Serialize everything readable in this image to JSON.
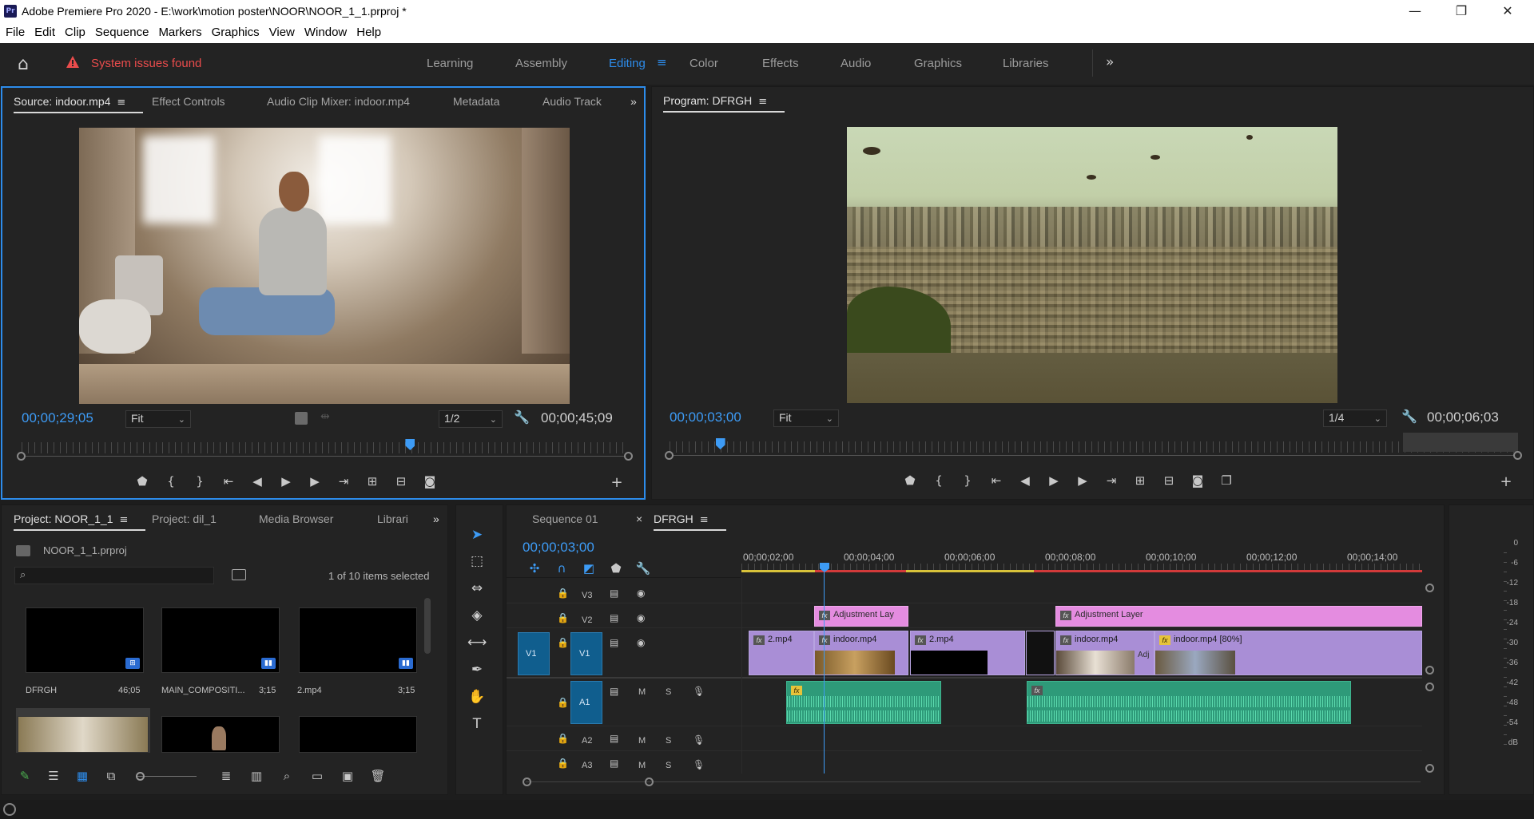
{
  "window": {
    "title": "Adobe Premiere Pro 2020 - E:\\work\\motion poster\\NOOR\\NOOR_1_1.prproj *",
    "app_badge": "Pr",
    "minimize": "—",
    "restore": "❐",
    "close": "✕"
  },
  "menu": [
    "File",
    "Edit",
    "Clip",
    "Sequence",
    "Markers",
    "Graphics",
    "View",
    "Window",
    "Help"
  ],
  "workspace": {
    "warning": "System issues found",
    "tabs": [
      "Learning",
      "Assembly",
      "Editing",
      "Color",
      "Effects",
      "Audio",
      "Graphics",
      "Libraries"
    ],
    "active": "Editing",
    "overflow": "»"
  },
  "source_monitor": {
    "tabs": [
      "Source: indoor.mp4",
      "Effect Controls",
      "Audio Clip Mixer: indoor.mp4",
      "Metadata",
      "Audio Track"
    ],
    "overflow": "»",
    "timecode": "00;00;29;05",
    "zoom": "Fit",
    "resolution": "1/2",
    "duration": "00;00;45;09",
    "playhead_fraction": 0.64
  },
  "program_monitor": {
    "tab": "Program: DFRGH",
    "timecode": "00;00;03;00",
    "zoom": "Fit",
    "resolution": "1/4",
    "duration": "00;00;06;03",
    "playhead_fraction": 0.06
  },
  "project": {
    "tabs": [
      "Project: NOOR_1_1",
      "Project: dil_1",
      "Media Browser",
      "Librari"
    ],
    "overflow": "»",
    "file": "NOOR_1_1.prproj",
    "selection": "1 of 10 items selected",
    "items": [
      {
        "name": "DFRGH",
        "duration": "46;05"
      },
      {
        "name": "MAIN_COMPOSITI...",
        "duration": "3;15"
      },
      {
        "name": "2.mp4",
        "duration": "3;15"
      }
    ]
  },
  "timeline": {
    "tabs": [
      "Sequence 01",
      "DFRGH"
    ],
    "active": "DFRGH",
    "close": "×",
    "timecode": "00;00;03;00",
    "ruler": [
      "00;00;02;00",
      "00;00;04;00",
      "00;00;06;00",
      "00;00;08;00",
      "00;00;10;00",
      "00;00;12;00",
      "00;00;14;00"
    ],
    "tracks": {
      "video": [
        "V3",
        "V2",
        "V1"
      ],
      "audio": [
        "A1",
        "A2",
        "A3"
      ],
      "source_v": "V1",
      "source_a": "A1"
    },
    "clips": {
      "adj1": "Adjustment Lay",
      "adj2": "Adjustment Layer",
      "v1": "2.mp4",
      "v2": "indoor.mp4",
      "v3": "2.mp4",
      "v4": "indoor.mp4",
      "v5": "indoor.mp4 [80%]",
      "fx": "fx",
      "v4_overlay": "Adj"
    },
    "track_toggles": {
      "mute": "M",
      "solo": "S"
    }
  },
  "audio_meter": [
    "0",
    "-6",
    "-12",
    "-18",
    "-24",
    "-30",
    "-36",
    "-42",
    "-48",
    "-54",
    "dB"
  ],
  "colors": {
    "accent": "#2d8ceb",
    "warning": "#ea4c4c",
    "video_clip": "#a98ed6",
    "adjustment_clip": "#e48ce0",
    "audio_clip": "#2e9a79"
  }
}
